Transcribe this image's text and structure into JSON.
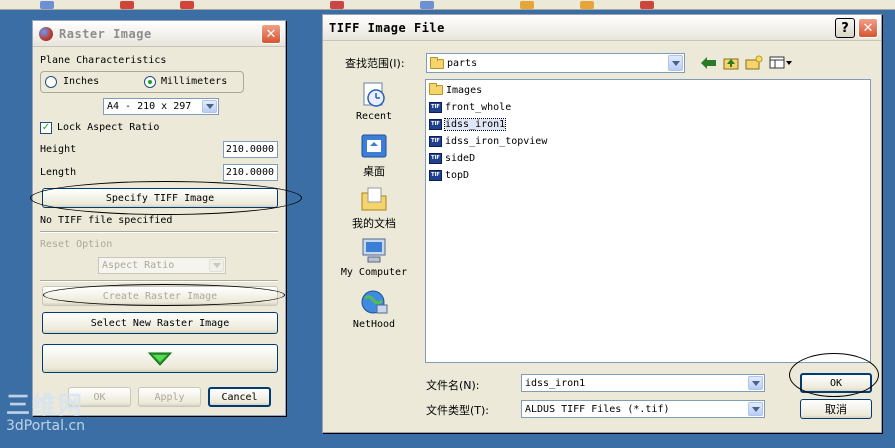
{
  "raster": {
    "title": "Raster Image",
    "plane_characteristics": "Plane Characteristics",
    "unit_inches": "Inches",
    "unit_millimeters": "Millimeters",
    "paper_size": "A4 - 210 x 297",
    "lock_aspect_ratio": "Lock Aspect Ratio",
    "height_label": "Height",
    "height_value": "210.0000",
    "length_label": "Length",
    "length_value": "210.0000",
    "specify_tiff_button": "Specify TIFF Image",
    "no_tiff_status": "No TIFF file specified",
    "reset_option": "Reset Option",
    "aspect_ratio": "Aspect Ratio",
    "create_raster_button": "Create Raster Image",
    "select_new_raster_button": "Select New Raster Image",
    "ok_button": "OK",
    "apply_button": "Apply",
    "cancel_button": "Cancel"
  },
  "tiff": {
    "title": "TIFF Image File",
    "look_in_label": "查找范围(I):",
    "look_in_value": "parts",
    "places": [
      {
        "label": "Recent"
      },
      {
        "label": "桌面"
      },
      {
        "label": "我的文档"
      },
      {
        "label": "My Computer"
      },
      {
        "label": "NetHood"
      }
    ],
    "files": [
      {
        "name": "Images"
      },
      {
        "name": "front_whole"
      },
      {
        "name": "idss_iron1"
      },
      {
        "name": "idss_iron_topview"
      },
      {
        "name": "sideD"
      },
      {
        "name": "topD"
      }
    ],
    "file_icon_text": "TIF",
    "filename_label": "文件名(N):",
    "filename_value": "idss_iron1",
    "filetype_label": "文件类型(T):",
    "filetype_value": "ALDUS TIFF Files (*.tif)",
    "ok_button": "OK",
    "cancel_button": "取消",
    "help_button": "?"
  },
  "watermark": {
    "main": "三维网",
    "sub": "3dPortal.cn"
  },
  "colors": {
    "accent_green": "#21a121",
    "title_blue": "#0a246a",
    "dialog_bg": "#ece9d8",
    "close_red": "#e35a3a"
  }
}
